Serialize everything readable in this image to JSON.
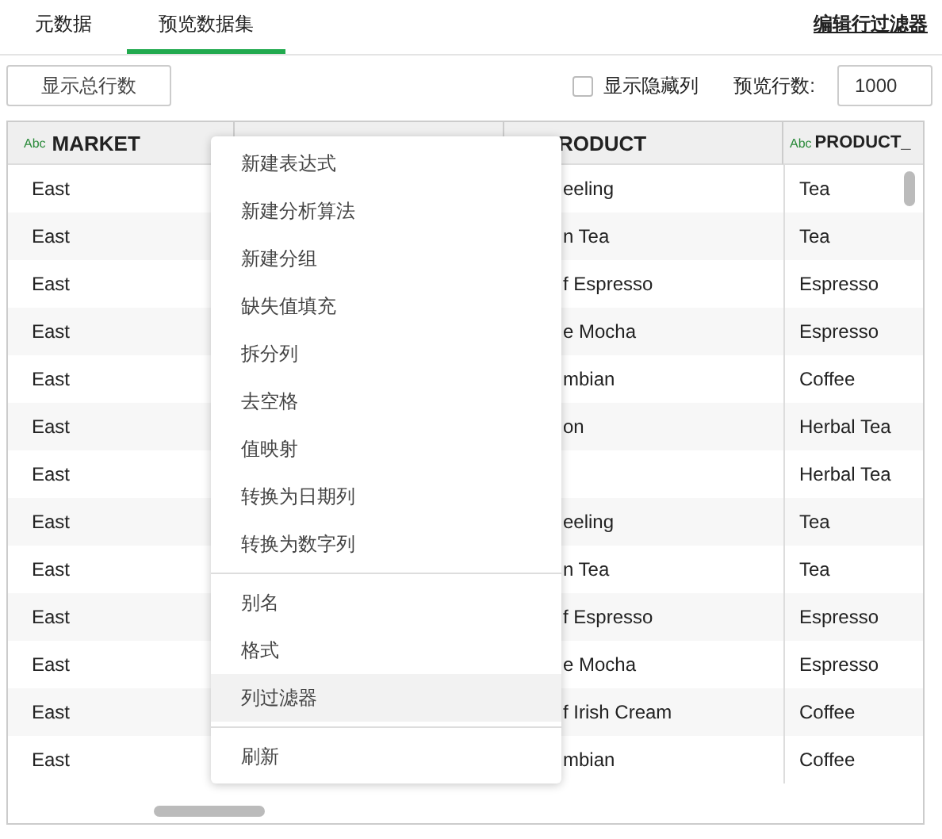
{
  "tabs": [
    {
      "label": "元数据",
      "selected": false
    },
    {
      "label": "预览数据集",
      "selected": true
    }
  ],
  "edit_row_filter_link": "编辑行过滤器",
  "toolbar": {
    "show_total_button": "显示总行数",
    "show_hidden_columns": {
      "label": "显示隐藏列",
      "checked": false
    },
    "preview_rows_label": "预览行数:",
    "preview_rows_value": "1000"
  },
  "table": {
    "columns": [
      {
        "type_badge": "Abc",
        "header": "MARKET"
      },
      {},
      {
        "header": "RODUCT"
      },
      {
        "type_badge": "Abc",
        "header": "PRODUCT_"
      }
    ],
    "rows": [
      [
        "East",
        null,
        "eeling",
        "Tea"
      ],
      [
        "East",
        null,
        "n Tea",
        "Tea"
      ],
      [
        "East",
        null,
        "f Espresso",
        "Espresso"
      ],
      [
        "East",
        null,
        "e Mocha",
        "Espresso"
      ],
      [
        "East",
        null,
        "mbian",
        "Coffee"
      ],
      [
        "East",
        null,
        "on",
        "Herbal Tea"
      ],
      [
        "East",
        null,
        null,
        "Herbal Tea"
      ],
      [
        "East",
        null,
        "eeling",
        "Tea"
      ],
      [
        "East",
        null,
        "n Tea",
        "Tea"
      ],
      [
        "East",
        null,
        "f Espresso",
        "Espresso"
      ],
      [
        "East",
        null,
        "e Mocha",
        "Espresso"
      ],
      [
        "East",
        null,
        "f Irish Cream",
        "Coffee"
      ],
      [
        "East",
        null,
        "mbian",
        "Coffee"
      ]
    ]
  },
  "context_menu": {
    "groups": [
      [
        {
          "label": "新建表达式",
          "highlighted": false
        },
        {
          "label": "新建分析算法",
          "highlighted": false
        },
        {
          "label": "新建分组",
          "highlighted": false
        },
        {
          "label": "缺失值填充",
          "highlighted": false
        },
        {
          "label": "拆分列",
          "highlighted": false
        },
        {
          "label": "去空格",
          "highlighted": false
        },
        {
          "label": "值映射",
          "highlighted": false
        },
        {
          "label": "转换为日期列",
          "highlighted": false
        },
        {
          "label": "转换为数字列",
          "highlighted": false
        }
      ],
      [
        {
          "label": "别名",
          "highlighted": false
        },
        {
          "label": "格式",
          "highlighted": false
        },
        {
          "label": "列过滤器",
          "highlighted": true
        }
      ],
      [
        {
          "label": "刷新",
          "highlighted": false
        }
      ]
    ]
  }
}
